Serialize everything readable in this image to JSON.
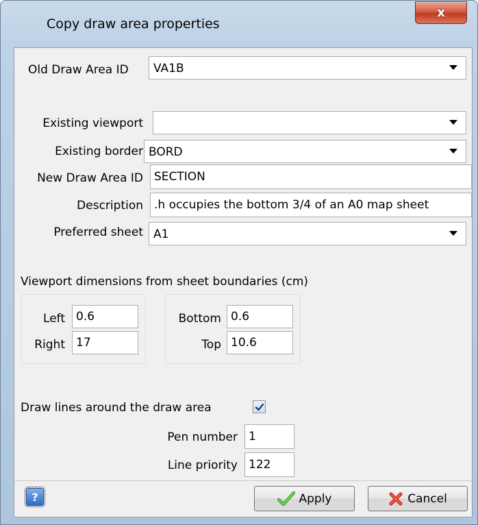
{
  "window": {
    "title": "Copy draw area properties",
    "close_label": "x"
  },
  "form": {
    "old_draw_area_id": {
      "label": "Old Draw Area ID",
      "value": "VA1B"
    },
    "existing_viewport": {
      "label": "Existing viewport",
      "value": ""
    },
    "existing_border": {
      "label": "Existing border",
      "value": "BORD"
    },
    "new_draw_area_id": {
      "label": "New Draw Area ID",
      "value": "SECTION"
    },
    "description": {
      "label": "Description",
      "value": "h occupies the bottom 3/4 of an A0 map sheet."
    },
    "preferred_sheet": {
      "label": "Preferred sheet",
      "value": "A1"
    }
  },
  "viewport_dimensions": {
    "heading": "Viewport dimensions from sheet boundaries (cm)",
    "left": {
      "label": "Left",
      "value": "0.6"
    },
    "right": {
      "label": "Right",
      "value": "17"
    },
    "bottom": {
      "label": "Bottom",
      "value": "0.6"
    },
    "top": {
      "label": "Top",
      "value": "10.6"
    }
  },
  "draw_lines": {
    "label": "Draw lines around the draw area",
    "checked": true,
    "pen_number": {
      "label": "Pen number",
      "value": "1"
    },
    "line_priority": {
      "label": "Line priority",
      "value": "122"
    }
  },
  "buttons": {
    "help": "?",
    "apply": "Apply",
    "cancel": "Cancel"
  }
}
